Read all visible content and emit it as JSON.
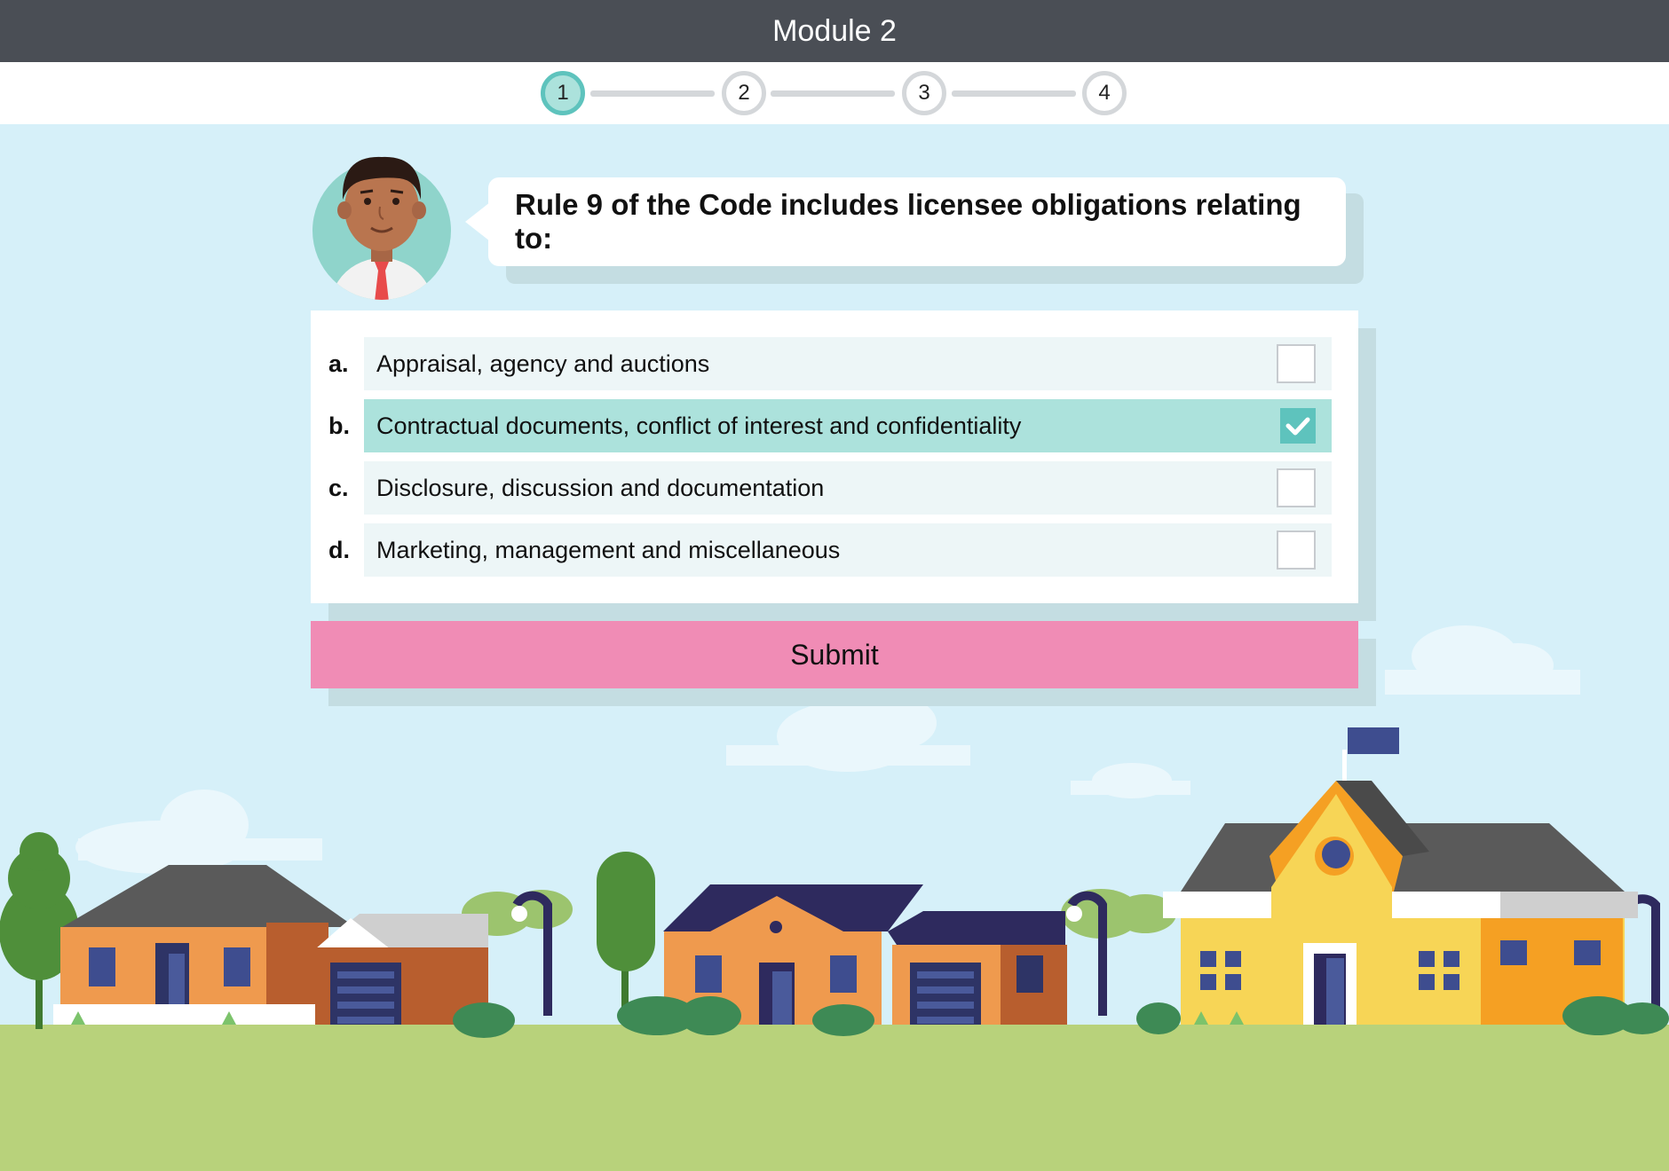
{
  "header": {
    "title": "Module 2"
  },
  "stepper": {
    "steps": [
      {
        "label": "1",
        "active": true
      },
      {
        "label": "2",
        "active": false
      },
      {
        "label": "3",
        "active": false
      },
      {
        "label": "4",
        "active": false
      }
    ]
  },
  "question": {
    "text": "Rule 9 of the Code includes licensee obligations relating to:"
  },
  "options": [
    {
      "letter": "a.",
      "text": "Appraisal, agency and auctions",
      "checked": false
    },
    {
      "letter": "b.",
      "text": "Contractual documents, conflict of interest and confidentiality",
      "checked": true
    },
    {
      "letter": "c.",
      "text": "Disclosure, discussion and documentation",
      "checked": false
    },
    {
      "letter": "d.",
      "text": "Marketing, management and miscellaneous",
      "checked": false
    }
  ],
  "submit": {
    "label": "Submit"
  },
  "colors": {
    "topbar": "#4a4e55",
    "accent": "#5ec3bd",
    "selected_row": "#ace2dc",
    "submit": "#f08cb5",
    "sky": "#d6f0f9",
    "grass": "#b8d27b"
  }
}
